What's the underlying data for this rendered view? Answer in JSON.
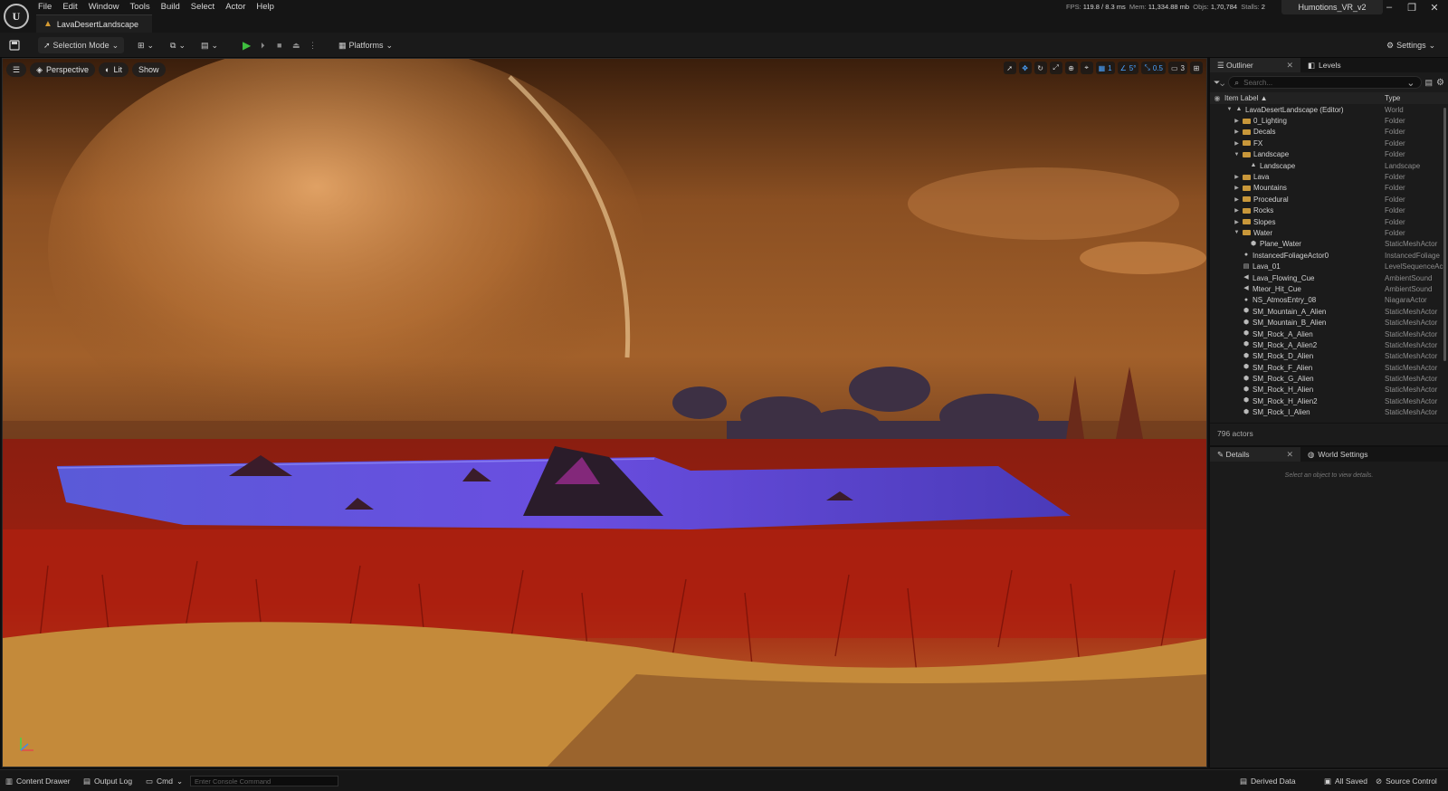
{
  "menu": [
    "File",
    "Edit",
    "Window",
    "Tools",
    "Build",
    "Select",
    "Actor",
    "Help"
  ],
  "document_tab": "LavaDesertLandscape",
  "stats": {
    "fps_label": "FPS:",
    "fps": "119.8 / 8.3 ms",
    "mem_label": "Mem:",
    "mem": "11,334.88 mb",
    "objs_label": "Objs:",
    "objs": "1,70,784",
    "stalls_label": "Stalls:",
    "stalls": "2"
  },
  "project_tab": "Humotions_VR_v2",
  "toolbar": {
    "selection_mode": "Selection Mode",
    "platforms": "Platforms",
    "settings": "Settings"
  },
  "viewport": {
    "menu_icon": "hamburger-icon",
    "perspective": "Perspective",
    "lit": "Lit",
    "show": "Show",
    "grid_snap": "1",
    "rotation_snap": "5°",
    "scale_snap": "0.5",
    "camera_speed": "3"
  },
  "outliner": {
    "tab": "Outliner",
    "levels_tab": "Levels",
    "search_placeholder": "Search...",
    "col_label": "Item Label ▲",
    "col_type": "Type",
    "rows": [
      {
        "label": "LavaDesertLandscape (Editor)",
        "type": "World",
        "depth": 0,
        "arrow": "▼",
        "icon": "world"
      },
      {
        "label": "0_Lighting",
        "type": "Folder",
        "depth": 1,
        "arrow": "▶",
        "icon": "folder"
      },
      {
        "label": "Decals",
        "type": "Folder",
        "depth": 1,
        "arrow": "▶",
        "icon": "folder"
      },
      {
        "label": "FX",
        "type": "Folder",
        "depth": 1,
        "arrow": "▶",
        "icon": "folder"
      },
      {
        "label": "Landscape",
        "type": "Folder",
        "depth": 1,
        "arrow": "▼",
        "icon": "folder"
      },
      {
        "label": "Landscape",
        "type": "Landscape",
        "depth": 2,
        "arrow": "",
        "icon": "landscape"
      },
      {
        "label": "Lava",
        "type": "Folder",
        "depth": 1,
        "arrow": "▶",
        "icon": "folder"
      },
      {
        "label": "Mountains",
        "type": "Folder",
        "depth": 1,
        "arrow": "▶",
        "icon": "folder"
      },
      {
        "label": "Procedural",
        "type": "Folder",
        "depth": 1,
        "arrow": "▶",
        "icon": "folder"
      },
      {
        "label": "Rocks",
        "type": "Folder",
        "depth": 1,
        "arrow": "▶",
        "icon": "folder"
      },
      {
        "label": "Slopes",
        "type": "Folder",
        "depth": 1,
        "arrow": "▶",
        "icon": "folder"
      },
      {
        "label": "Water",
        "type": "Folder",
        "depth": 1,
        "arrow": "▼",
        "icon": "folder"
      },
      {
        "label": "Plane_Water",
        "type": "StaticMeshActor",
        "depth": 2,
        "arrow": "",
        "icon": "mesh"
      },
      {
        "label": "InstancedFoliageActor0",
        "type": "InstancedFoliage",
        "depth": 1,
        "arrow": "",
        "icon": "actor"
      },
      {
        "label": "Lava_01",
        "type": "LevelSequenceAc",
        "depth": 1,
        "arrow": "",
        "icon": "sequence"
      },
      {
        "label": "Lava_Flowing_Cue",
        "type": "AmbientSound",
        "depth": 1,
        "arrow": "",
        "icon": "sound"
      },
      {
        "label": "Mteor_Hit_Cue",
        "type": "AmbientSound",
        "depth": 1,
        "arrow": "",
        "icon": "sound"
      },
      {
        "label": "NS_AtmosEntry_08",
        "type": "NiagaraActor",
        "depth": 1,
        "arrow": "",
        "icon": "actor"
      },
      {
        "label": "SM_Mountain_A_Alien",
        "type": "StaticMeshActor",
        "depth": 1,
        "arrow": "",
        "icon": "mesh"
      },
      {
        "label": "SM_Mountain_B_Alien",
        "type": "StaticMeshActor",
        "depth": 1,
        "arrow": "",
        "icon": "mesh"
      },
      {
        "label": "SM_Rock_A_Alien",
        "type": "StaticMeshActor",
        "depth": 1,
        "arrow": "",
        "icon": "mesh"
      },
      {
        "label": "SM_Rock_A_Alien2",
        "type": "StaticMeshActor",
        "depth": 1,
        "arrow": "",
        "icon": "mesh"
      },
      {
        "label": "SM_Rock_D_Alien",
        "type": "StaticMeshActor",
        "depth": 1,
        "arrow": "",
        "icon": "mesh"
      },
      {
        "label": "SM_Rock_F_Alien",
        "type": "StaticMeshActor",
        "depth": 1,
        "arrow": "",
        "icon": "mesh"
      },
      {
        "label": "SM_Rock_G_Alien",
        "type": "StaticMeshActor",
        "depth": 1,
        "arrow": "",
        "icon": "mesh"
      },
      {
        "label": "SM_Rock_H_Alien",
        "type": "StaticMeshActor",
        "depth": 1,
        "arrow": "",
        "icon": "mesh"
      },
      {
        "label": "SM_Rock_H_Alien2",
        "type": "StaticMeshActor",
        "depth": 1,
        "arrow": "",
        "icon": "mesh"
      },
      {
        "label": "SM_Rock_I_Alien",
        "type": "StaticMeshActor",
        "depth": 1,
        "arrow": "",
        "icon": "mesh"
      }
    ],
    "actor_count": "796 actors"
  },
  "details": {
    "tab": "Details",
    "world_settings_tab": "World Settings",
    "hint": "Select an object to view details."
  },
  "statusbar": {
    "content_drawer": "Content Drawer",
    "output_log": "Output Log",
    "cmd": "Cmd",
    "console_placeholder": "Enter Console Command",
    "derived_data": "Derived Data",
    "all_saved": "All Saved",
    "source_control": "Source Control"
  },
  "colors": {
    "accent": "#4aa3ff",
    "play": "#3fbf3f",
    "folder": "#c8973a"
  }
}
